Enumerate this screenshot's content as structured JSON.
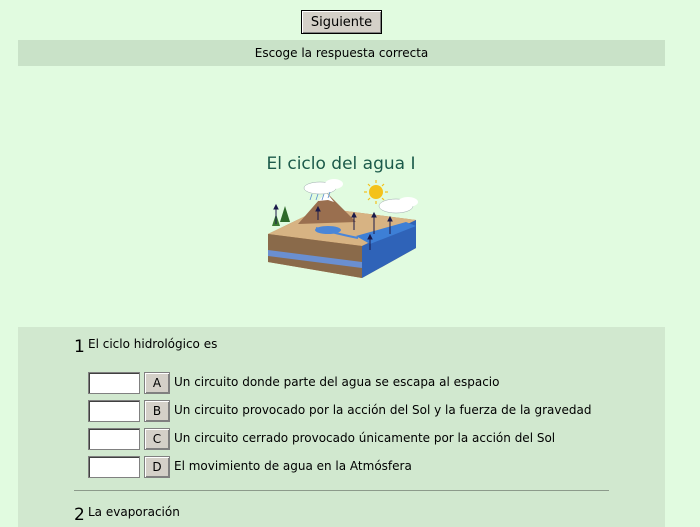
{
  "toolbar": {
    "next_label": "Siguiente"
  },
  "instruction": "Escoge la respuesta correcta",
  "title": "El ciclo del agua I",
  "questions": [
    {
      "number": "1",
      "text": "El ciclo hidrológico es",
      "answers": [
        {
          "letter": "A",
          "text": "Un circuito donde parte del agua se escapa al espacio",
          "value": ""
        },
        {
          "letter": "B",
          "text": "Un circuito provocado por la acción del Sol y la fuerza de la gravedad",
          "value": ""
        },
        {
          "letter": "C",
          "text": "Un circuito cerrado provocado únicamente por la acción del Sol",
          "value": ""
        },
        {
          "letter": "D",
          "text": "El movimiento de agua en la Atmósfera",
          "value": ""
        }
      ]
    },
    {
      "number": "2",
      "text": "La evaporación"
    }
  ],
  "colors": {
    "page_bg": "#e1fbe0",
    "bar_bg": "#c9e2c8",
    "quiz_bg": "#d1e8cf",
    "title_color": "#1b5a4a"
  }
}
